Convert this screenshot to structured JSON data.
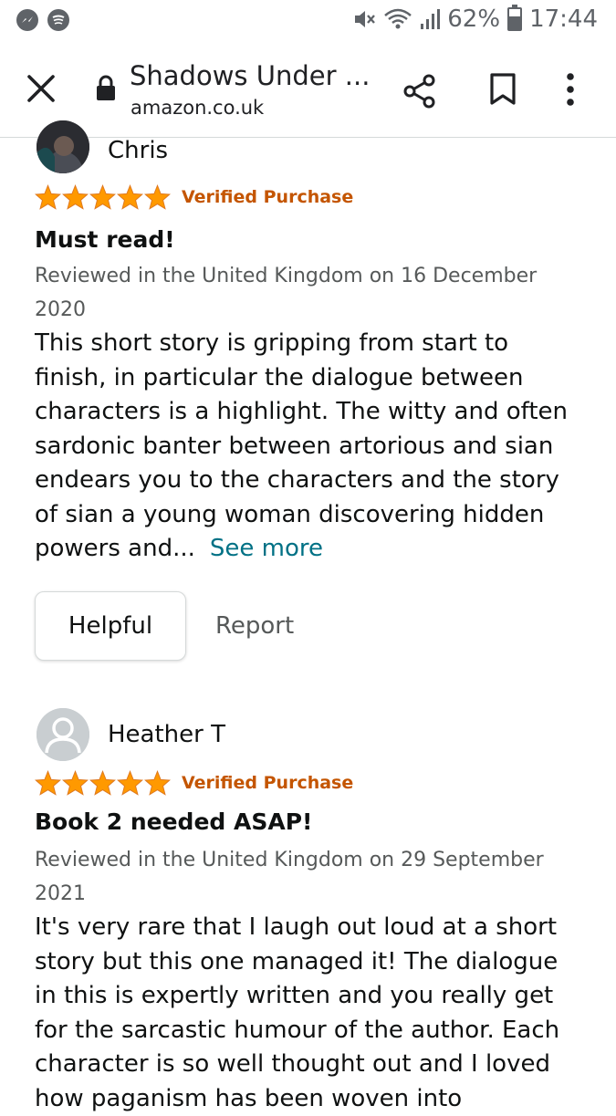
{
  "status_bar": {
    "battery_level": "62%",
    "time": "17:44",
    "icons": [
      "messenger-icon",
      "spotify-icon",
      "mute-icon",
      "wifi-icon",
      "signal-icon",
      "battery-icon"
    ]
  },
  "browser": {
    "page_title": "Shadows Under ...",
    "domain": "amazon.co.uk",
    "icons": [
      "close-icon",
      "lock-icon",
      "share-icon",
      "bookmark-icon",
      "more-vert-icon"
    ]
  },
  "reviews": [
    {
      "reviewer": "Chris",
      "stars": 5,
      "verified_label": "Verified Purchase",
      "headline": "Must read!",
      "date": "Reviewed in the United Kingdom on 16 December 2020",
      "body": "This short story is gripping from start to finish, in particular the dialogue between characters is a highlight. The witty and often sardonic banter between artorious and sian endears you to the characters and the story of sian a young woman discovering hidden powers and...",
      "see_more": "See more",
      "helpful_label": "Helpful",
      "report_label": "Report"
    },
    {
      "reviewer": "Heather T",
      "stars": 5,
      "verified_label": "Verified Purchase",
      "headline": "Book 2 needed ASAP!",
      "date": "Reviewed in the United Kingdom on 29 September 2021",
      "body": "It's very rare that I laugh out loud at a short story but this one managed it! The dialogue in this is expertly written and you really get for the sarcastic humour of the author. Each character is so well thought out and I loved how paganism has been woven into"
    }
  ],
  "colors": {
    "star": "#ff9900",
    "verified": "#c45500",
    "link": "#007185",
    "muted_text": "#565959"
  }
}
